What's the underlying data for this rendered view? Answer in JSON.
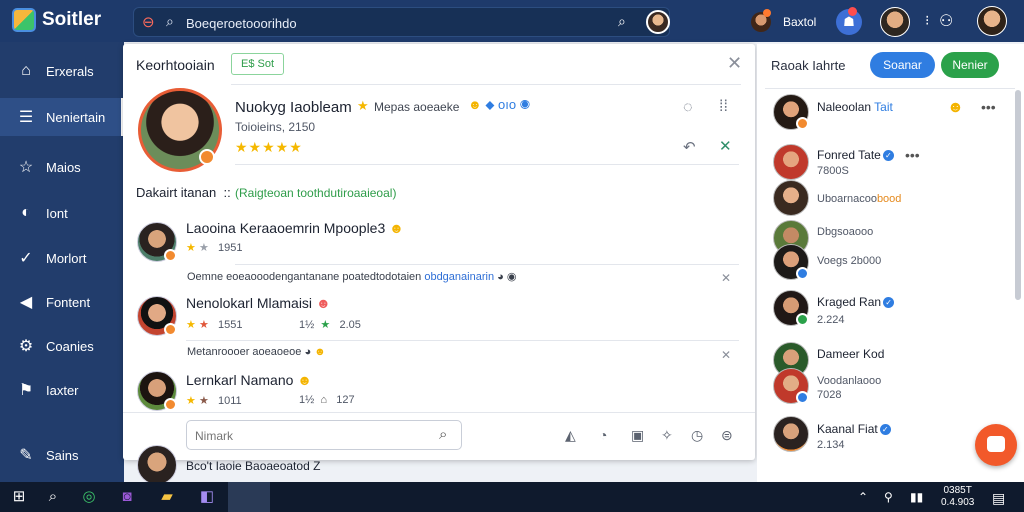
{
  "app": {
    "name": "Soitler"
  },
  "search": {
    "value": "Boeqeroetooorihdo"
  },
  "topbar": {
    "user_label": "Baxtol"
  },
  "nav": {
    "items": [
      {
        "label": "Erxerals"
      },
      {
        "label": "Neniertain"
      },
      {
        "label": "Maios"
      },
      {
        "label": "Iont"
      },
      {
        "label": "Morlort"
      },
      {
        "label": "Fontent"
      },
      {
        "label": "Coanies"
      },
      {
        "label": "Iaxter"
      },
      {
        "label": "Sains"
      }
    ]
  },
  "panel": {
    "title": "Keorhtooiain",
    "chip": "E$ Sot",
    "profile": {
      "name": "Nuokyg Iaobleam",
      "tag": "Mepas aoeaeke",
      "tag_tail": "oıo",
      "meta": "Toioieins, 2150"
    },
    "section_label": "Dakairt itanan",
    "section_sep": "::",
    "section_link": "(Raigteoan toothdutiroaaieoal)",
    "comments": [
      {
        "name": "Laooina Keraaoemrin Mpoople3",
        "rating": "1951",
        "reply_count": "",
        "score": ""
      },
      {
        "name": "Nenolokarl Mlamaisi",
        "rating": "1551",
        "reply_count": "1½",
        "score": "2.05"
      },
      {
        "name": "Lernkarl Namano",
        "rating": "1011",
        "reply_count": "1½",
        "score": "127"
      }
    ],
    "replies": [
      {
        "text": "Oemne eoeaooodengantanane poatedtodotaien",
        "link": "obdganainarin"
      },
      {
        "text": "Metanroooer aoeaoeoe",
        "link": ""
      }
    ],
    "composer_placeholder": "Nimark",
    "peek": {
      "name": "Bco't",
      "text": "Iaoie Baoaeoatod",
      "count": "Z"
    }
  },
  "right_panel": {
    "title": "Raoak Iahrte",
    "btn_primary": "Soanar",
    "btn_secondary": "Nenier",
    "contacts": [
      {
        "name": "Naleoolan",
        "tag": "Tait",
        "meta": "",
        "meta_hl": ""
      },
      {
        "name": "Fonred Tate",
        "tag": "",
        "meta": "7800S",
        "meta_hl": ""
      },
      {
        "name": "",
        "tag": "",
        "meta": "Uboarnacoo",
        "meta_hl": "bood"
      },
      {
        "name": "",
        "tag": "",
        "meta": "Dbgsoaooo",
        "meta_hl": ""
      },
      {
        "name": "",
        "tag": "",
        "meta": "Voegs 2b000",
        "meta_hl": ""
      },
      {
        "name": "Kraged Ran",
        "tag": "",
        "meta": "2.224",
        "meta_hl": ""
      },
      {
        "name": "Dameer Kod",
        "tag": "",
        "meta": "Voodanlaooo",
        "meta_hl": ""
      },
      {
        "name": "",
        "tag": "",
        "meta": "7028",
        "meta_hl": ""
      },
      {
        "name": "Kaanal Fiat",
        "tag": "",
        "meta": "2.134",
        "meta_hl": ""
      }
    ]
  },
  "taskbar": {
    "clock_time": "0385T",
    "clock_date": "0.4.903"
  },
  "colors": {
    "topbar": "#1e3a6b",
    "nav": "#223d6c",
    "primary": "#2f7de1",
    "success": "#2ba14a",
    "accent": "#f2592a",
    "rating": "#f5b800"
  }
}
